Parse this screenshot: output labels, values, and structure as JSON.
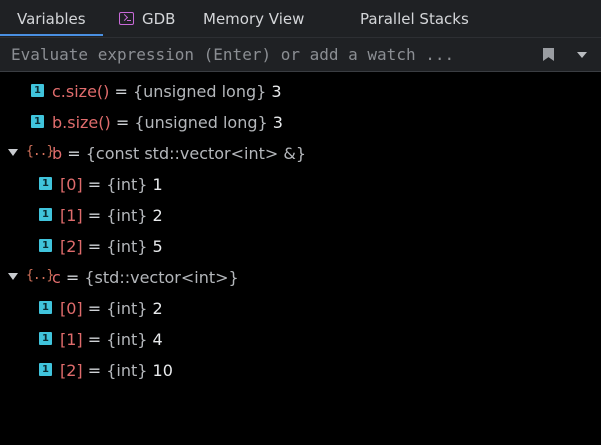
{
  "tabs": [
    {
      "label": "Variables",
      "active": true
    },
    {
      "label": "GDB",
      "icon": "terminal-icon"
    },
    {
      "label": "Memory View"
    },
    {
      "label": "Parallel Stacks",
      "icon": "parallel-stacks-icon"
    }
  ],
  "evaluate": {
    "placeholder": "Evaluate expression (Enter) or add a watch ..."
  },
  "colors": {
    "active_tab_underline": "#4a90e2",
    "variable_name": "#e06c6c",
    "primitive_icon": "#40c4dc",
    "struct_icon": "#d5735c"
  },
  "variables": [
    {
      "name": "c.size()",
      "eq": "=",
      "type": "{unsigned long}",
      "value": "3",
      "kind": "primitive",
      "depth": 0
    },
    {
      "name": "b.size()",
      "eq": "=",
      "type": "{unsigned long}",
      "value": "3",
      "kind": "primitive",
      "depth": 0
    },
    {
      "name": "b",
      "eq": "=",
      "type": "{const std::vector<int> &}",
      "value": "",
      "kind": "struct",
      "expanded": true,
      "depth": 0
    },
    {
      "name": "[0]",
      "eq": "=",
      "type": "{int}",
      "value": "1",
      "kind": "primitive",
      "depth": 1
    },
    {
      "name": "[1]",
      "eq": "=",
      "type": "{int}",
      "value": "2",
      "kind": "primitive",
      "depth": 1
    },
    {
      "name": "[2]",
      "eq": "=",
      "type": "{int}",
      "value": "5",
      "kind": "primitive",
      "depth": 1
    },
    {
      "name": "c",
      "eq": "=",
      "type": "{std::vector<int>}",
      "value": "",
      "kind": "struct",
      "expanded": true,
      "depth": 0
    },
    {
      "name": "[0]",
      "eq": "=",
      "type": "{int}",
      "value": "2",
      "kind": "primitive",
      "depth": 1
    },
    {
      "name": "[1]",
      "eq": "=",
      "type": "{int}",
      "value": "4",
      "kind": "primitive",
      "depth": 1
    },
    {
      "name": "[2]",
      "eq": "=",
      "type": "{int}",
      "value": "10",
      "kind": "primitive",
      "depth": 1
    }
  ],
  "icons": {
    "primitive_glyph": "1",
    "struct_glyph": "{..}"
  }
}
